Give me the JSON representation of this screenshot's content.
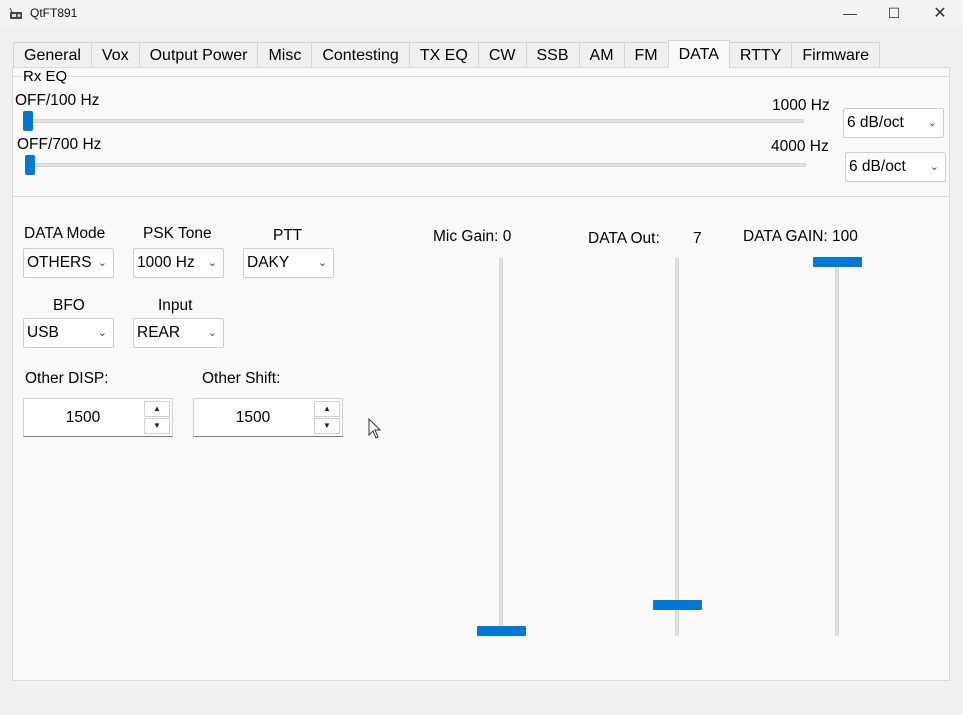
{
  "window": {
    "title": "QtFT891",
    "minimize_glyph": "—",
    "maximize_glyph": "☐",
    "close_glyph": "✕"
  },
  "tabs": [
    {
      "label": "General"
    },
    {
      "label": "Vox"
    },
    {
      "label": "Output Power"
    },
    {
      "label": "Misc"
    },
    {
      "label": "Contesting"
    },
    {
      "label": "TX EQ"
    },
    {
      "label": "CW"
    },
    {
      "label": "SSB"
    },
    {
      "label": "AM"
    },
    {
      "label": "FM"
    },
    {
      "label": "DATA",
      "active": true
    },
    {
      "label": "RTTY"
    },
    {
      "label": "Firmware"
    }
  ],
  "rx_eq": {
    "title": "Rx EQ",
    "low": {
      "min_label": "OFF/100 Hz",
      "max_label": "1000 Hz",
      "slope": "6 dB/oct"
    },
    "high": {
      "min_label": "OFF/700 Hz",
      "max_label": "4000 Hz",
      "slope": "6 dB/oct"
    }
  },
  "data": {
    "mode": {
      "label": "DATA Mode",
      "value": "OTHERS"
    },
    "psk_tone": {
      "label": "PSK Tone",
      "value": "1000 Hz"
    },
    "ptt": {
      "label": "PTT",
      "value": "DAKY"
    },
    "bfo": {
      "label": "BFO",
      "value": "USB"
    },
    "input": {
      "label": "Input",
      "value": "REAR"
    },
    "other_disp": {
      "label": "Other DISP:",
      "value": "1500"
    },
    "other_shift": {
      "label": "Other Shift:",
      "value": "1500"
    }
  },
  "sliders": {
    "mic_gain": {
      "label": "Mic Gain: 0",
      "value": 0
    },
    "data_out": {
      "label": "DATA Out:",
      "value_text": "7",
      "value": 7
    },
    "data_gain": {
      "label": "DATA GAIN: 100",
      "value": 100
    }
  },
  "icons": {
    "chevron": "⌄",
    "spin_up": "▲",
    "spin_down": "▼"
  }
}
